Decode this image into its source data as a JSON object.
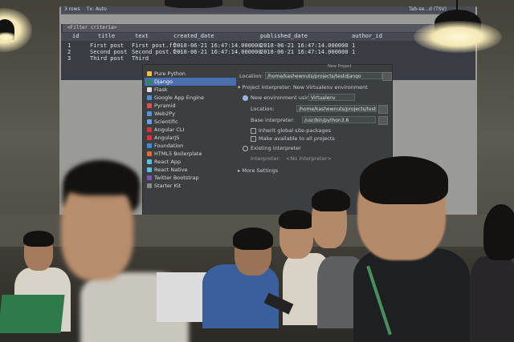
{
  "screen": {
    "filter_text": "<Filter criteria>",
    "toolbar": [
      "3 rows",
      "Tx: Auto",
      "Tab-se...d (TSV)"
    ],
    "columns": [
      "id",
      "title",
      "text",
      "created_date",
      "published_date",
      "author_id"
    ],
    "rows": [
      [
        "1",
        "First post",
        "First post.ff--",
        "2018-06-21 16:47:14.000000",
        "2018-06-21 16:47:14.000000",
        "1"
      ],
      [
        "2",
        "Second post",
        "Second post.f--",
        "2018-06-21 16:47:14.000000",
        "2018-06-21 16:47:14.000000",
        "1"
      ],
      [
        "3",
        "Third post",
        "Third",
        "",
        "",
        ""
      ]
    ]
  },
  "dialog": {
    "title": "New Project",
    "project_types": [
      {
        "label": "Pure Python",
        "color": "#f0c040"
      },
      {
        "label": "Django",
        "color": "#2e8b57",
        "selected": true
      },
      {
        "label": "Flask",
        "color": "#dddddd"
      },
      {
        "label": "Google App Engine",
        "color": "#4a90d9"
      },
      {
        "label": "Pyramid",
        "color": "#e0524d"
      },
      {
        "label": "Web2Py",
        "color": "#5b8fd6"
      },
      {
        "label": "Scientific",
        "color": "#6aa0e0"
      },
      {
        "label": "Angular CLI",
        "color": "#d9303a"
      },
      {
        "label": "AngularJS",
        "color": "#d9303a"
      },
      {
        "label": "Foundation",
        "color": "#3b8fd6"
      },
      {
        "label": "HTML5 Boilerplate",
        "color": "#e36b2c"
      },
      {
        "label": "React App",
        "color": "#5bc0de"
      },
      {
        "label": "React Native",
        "color": "#5bc0de"
      },
      {
        "label": "Twitter Bootstrap",
        "color": "#7a55b3"
      },
      {
        "label": "Starter Kit",
        "color": "#888888"
      }
    ],
    "location_label": "Location:",
    "location_value": "/home/kashewnuts/projects/testdjango",
    "interpreter_section": "Project Interpreter: New Virtualenv environment",
    "new_env_label": "New environment using",
    "env_tool": "Virtualenv",
    "env_location_label": "Location:",
    "env_location_value": "/home/kashewnuts/projects/test",
    "base_interpreter_label": "Base interpreter:",
    "base_interpreter_value": "/usr/bin/python3.6",
    "inherit_label": "Inherit global site-packages",
    "available_label": "Make available to all projects",
    "existing_label": "Existing interpreter",
    "interpreter_label": "Interpreter:",
    "interpreter_value": "<No interpreter>",
    "more_settings": "More Settings"
  },
  "colors": {
    "selection": "#4b6eaf",
    "dialog_bg": "#3c3f41",
    "lamp_glow": "#fff8d8"
  }
}
